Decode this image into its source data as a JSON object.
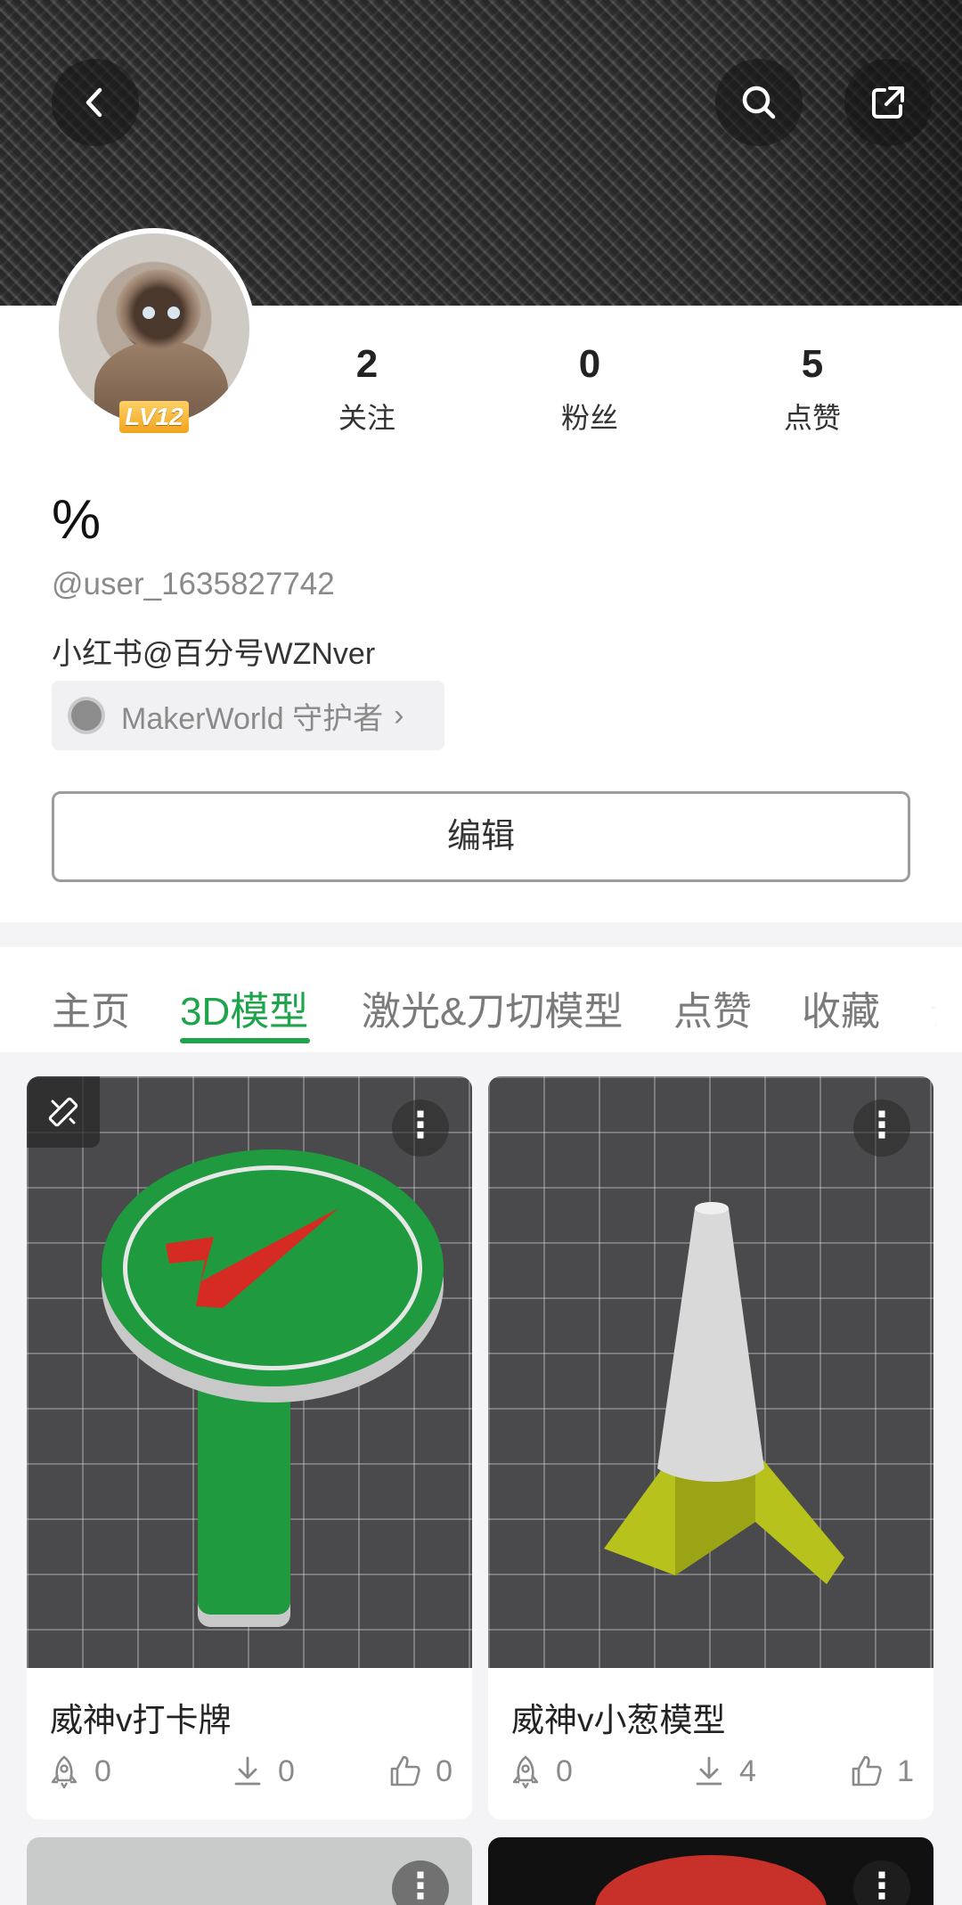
{
  "header": {
    "back_icon": "chevron-left-icon",
    "search_icon": "search-icon",
    "share_icon": "share-icon"
  },
  "profile": {
    "level": "LV12",
    "stats": [
      {
        "value": "2",
        "label": "关注"
      },
      {
        "value": "0",
        "label": "粉丝"
      },
      {
        "value": "5",
        "label": "点赞"
      }
    ],
    "nickname": "%",
    "handle": "@user_1635827742",
    "bio": "小红书@百分号WZNver",
    "badge": "MakerWorld 守护者",
    "edit_label": "编辑"
  },
  "tabs": [
    {
      "label": "主页",
      "active": false
    },
    {
      "label": "3D模型",
      "active": true
    },
    {
      "label": "激光&刀切模型",
      "active": false
    },
    {
      "label": "点赞",
      "active": false
    },
    {
      "label": "收藏",
      "active": false
    },
    {
      "label": "云",
      "active": false
    }
  ],
  "accent_color": "#1ea44a",
  "models": [
    {
      "title": "威神v打卡牌",
      "boosts": "0",
      "downloads": "0",
      "likes": "0"
    },
    {
      "title": "威神v小葱模型",
      "boosts": "0",
      "downloads": "4",
      "likes": "1"
    }
  ]
}
